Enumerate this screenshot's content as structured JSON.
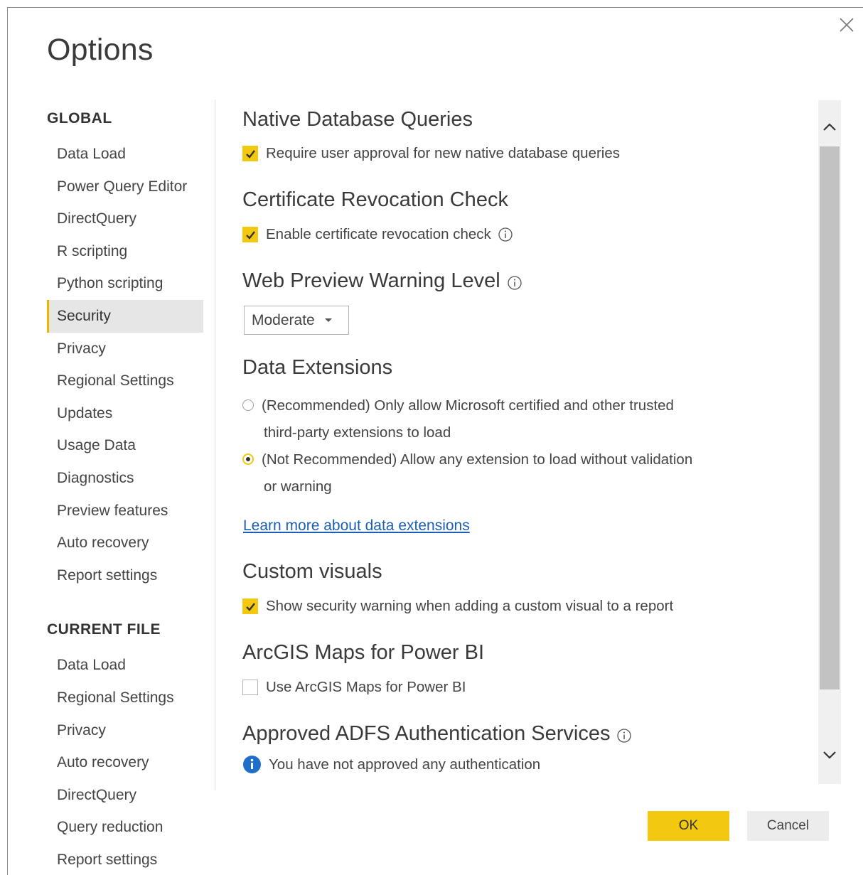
{
  "dialog": {
    "title": "Options"
  },
  "nav": {
    "global_heading": "GLOBAL",
    "global_items": [
      {
        "label": "Data Load"
      },
      {
        "label": "Power Query Editor"
      },
      {
        "label": "DirectQuery"
      },
      {
        "label": "R scripting"
      },
      {
        "label": "Python scripting"
      },
      {
        "label": "Security"
      },
      {
        "label": "Privacy"
      },
      {
        "label": "Regional Settings"
      },
      {
        "label": "Updates"
      },
      {
        "label": "Usage Data"
      },
      {
        "label": "Diagnostics"
      },
      {
        "label": "Preview features"
      },
      {
        "label": "Auto recovery"
      },
      {
        "label": "Report settings"
      }
    ],
    "selected": "Security",
    "current_file_heading": "CURRENT FILE",
    "current_file_items": [
      {
        "label": "Data Load"
      },
      {
        "label": "Regional Settings"
      },
      {
        "label": "Privacy"
      },
      {
        "label": "Auto recovery"
      },
      {
        "label": "DirectQuery"
      },
      {
        "label": "Query reduction"
      },
      {
        "label": "Report settings"
      }
    ]
  },
  "content": {
    "native_db": {
      "title": "Native Database Queries",
      "checkbox_label": "Require user approval for new native database queries",
      "checked": true
    },
    "cert_revocation": {
      "title": "Certificate Revocation Check",
      "checkbox_label": "Enable certificate revocation check",
      "checked": true
    },
    "web_preview": {
      "title": "Web Preview Warning Level",
      "selected_value": "Moderate"
    },
    "data_extensions": {
      "title": "Data Extensions",
      "option1_line1": "(Recommended) Only allow Microsoft certified and other trusted",
      "option1_line2": "third-party extensions to load",
      "option2_line1": "(Not Recommended) Allow any extension to load without validation",
      "option2_line2": "or warning",
      "selected_option": 2,
      "learn_more": "Learn more about data extensions"
    },
    "custom_visuals": {
      "title": "Custom visuals",
      "checkbox_label": "Show security warning when adding a custom visual to a report",
      "checked": true
    },
    "arcgis": {
      "title": "ArcGIS Maps for Power BI",
      "checkbox_label": "Use ArcGIS Maps for Power BI",
      "checked": false
    },
    "adfs": {
      "title": "Approved ADFS Authentication Services",
      "message": "You have not approved any authentication"
    }
  },
  "buttons": {
    "ok": "OK",
    "cancel": "Cancel"
  },
  "colors": {
    "accent": "#f2c811",
    "link": "#1b5fb5",
    "info_blue": "#1e6fc9"
  }
}
